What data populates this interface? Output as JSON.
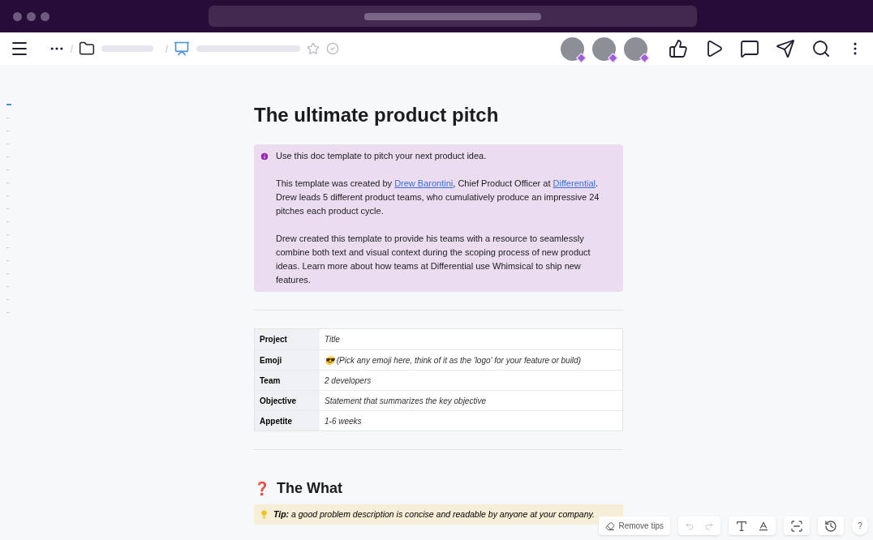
{
  "document": {
    "title": "The ultimate product pitch",
    "callout": {
      "intro": "Use this doc template to pitch your next product idea.",
      "paragraph_1": {
        "before": "This template was created by ",
        "link_1": "Drew Barontini",
        "middle": ", Chief Product Officer at ",
        "link_2": "Differential",
        "after": ". Drew leads 5 different product teams, who cumulatively produce an impressive 24 pitches each product cycle."
      },
      "paragraph_2": "Drew created this template to provide his teams with a resource to seamlessly combine both text and visual context during the scoping process of new product ideas. Learn more about how teams at Differential use Whimsical to ship new features."
    },
    "table": [
      {
        "label": "Project",
        "value": "Title"
      },
      {
        "label": "Emoji",
        "value": "😎 (Pick any emoji here, think of it as the 'logo' for your feature or build)"
      },
      {
        "label": "Team",
        "value": "2 developers"
      },
      {
        "label": "Objective",
        "value": "Statement that summarizes the key objective"
      },
      {
        "label": "Appetite",
        "value": "1-6 weeks"
      }
    ],
    "section_heading": {
      "emoji": "❓",
      "text": "The What"
    },
    "tip": "**Tip:** a good problem description is concise and readable by anyone at your company."
  },
  "bottom_toolbar": {
    "remove_tips": "Remove tips",
    "help": "?"
  }
}
